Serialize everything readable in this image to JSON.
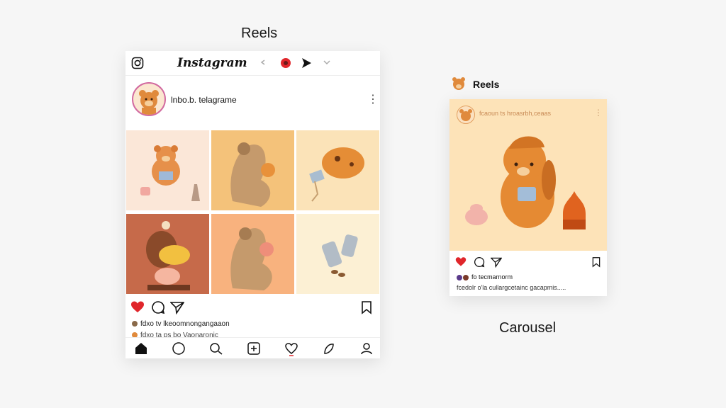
{
  "captions": {
    "reels_top": "Reels",
    "carousel": "Carousel"
  },
  "feed_card": {
    "brand": "Instagram",
    "username": "lnbo.b. telagrame",
    "more": "⋮",
    "caption_line1": "fdxo tv lkeoomnongangaaon",
    "caption_line2": "fdxo ta ps bo Vaonaronic",
    "icons": [
      "instagram-icon",
      "heart-icon",
      "comment-icon",
      "send-icon",
      "bookmark-icon",
      "home-icon",
      "search-icon",
      "add-icon",
      "activity-icon",
      "profile-icon"
    ]
  },
  "reels_card": {
    "label": "Reels",
    "username": "fcaoun ts hroasrbh,ceaas",
    "more": "⋮",
    "caption_line1": "fo tecmarnorm",
    "caption_line2": "fcedolr o'la cullargcetainc gacapmis....."
  },
  "colors": {
    "like_red": "#e0262b",
    "accent_orange": "#e8913a",
    "tile_peach": "#fbe3c8"
  }
}
